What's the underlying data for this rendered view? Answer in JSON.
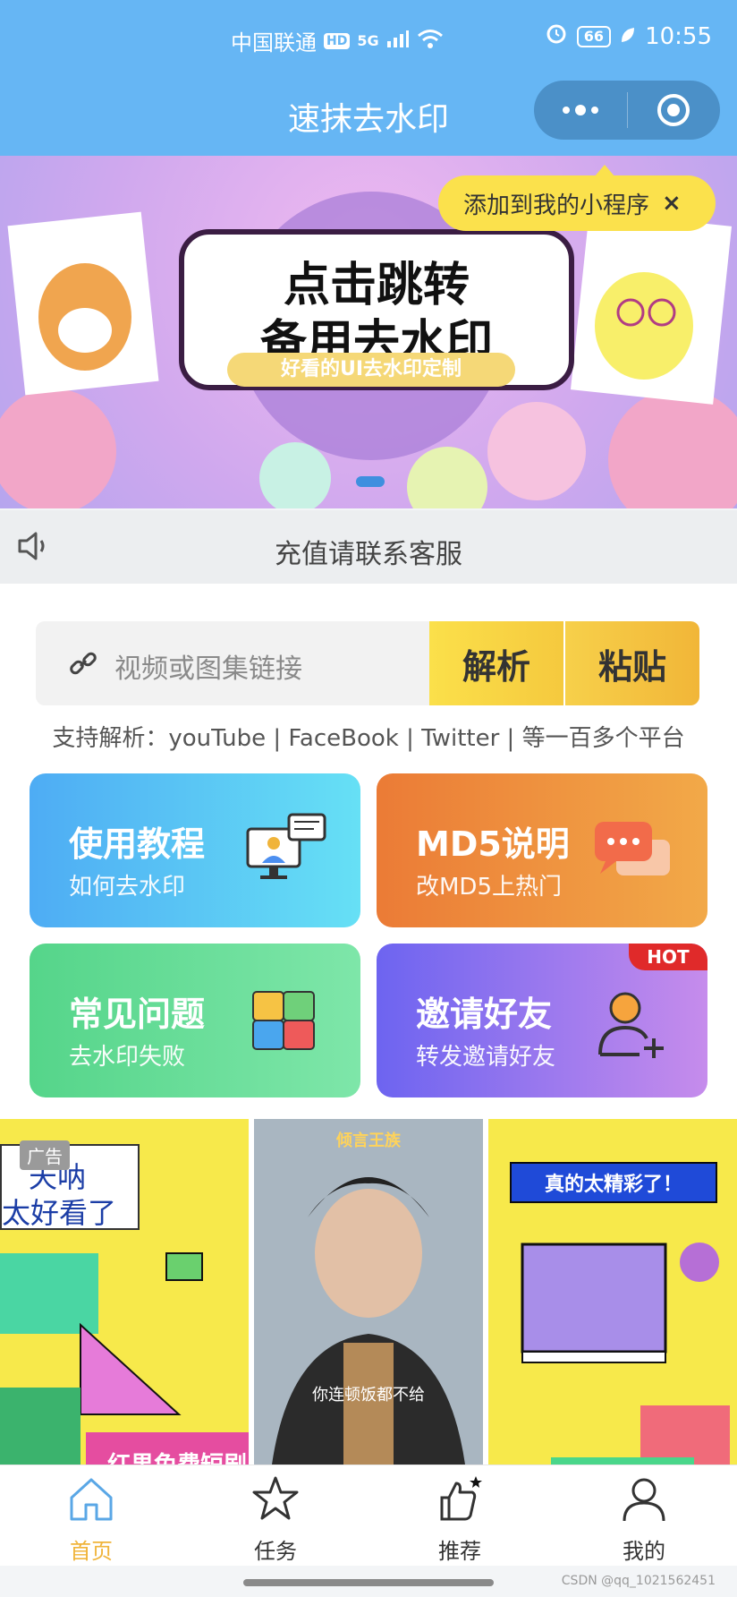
{
  "status_bar": {
    "carrier": "中国联通",
    "hd": "HD",
    "network": "5G",
    "battery": "66",
    "time": "10:55"
  },
  "title_bar": {
    "title": "速抹去水印"
  },
  "banner": {
    "line1": "点击跳转",
    "line2": "备用去水印",
    "subtitle": "好看的UI去水印定制"
  },
  "mini_program_tip": {
    "text": "添加到我的小程序",
    "close": "×"
  },
  "notice": {
    "text": "充值请联系客服"
  },
  "search": {
    "placeholder": "视频或图集链接",
    "parse_label": "解析",
    "paste_label": "粘贴"
  },
  "supported_platforms": "支持解析：youTube | FaceBook | Twitter | 等一百多个平台",
  "tiles": [
    {
      "title": "使用教程",
      "subtitle": "如何去水印"
    },
    {
      "title": "MD5说明",
      "subtitle": "改MD5上热门"
    },
    {
      "title": "常见问题",
      "subtitle": "去水印失败"
    },
    {
      "title": "邀请好友",
      "subtitle": "转发邀请好友",
      "badge": "HOT"
    }
  ],
  "ads": {
    "label": "广告",
    "ad1_line1": "天呐",
    "ad1_line2": "太好看了",
    "ad1_bottom": "红果免费短剧",
    "ad2_top": "倾言王族",
    "ad2_caption": "你连顿饭都不给",
    "ad3_banner": "真的太精彩了！"
  },
  "tabbar": {
    "items": [
      {
        "label": "首页"
      },
      {
        "label": "任务"
      },
      {
        "label": "推荐"
      },
      {
        "label": "我的"
      }
    ]
  },
  "watermark": "CSDN @qq_1021562451",
  "colors": {
    "header": "#66b6f4",
    "accent": "#f0b43a"
  }
}
